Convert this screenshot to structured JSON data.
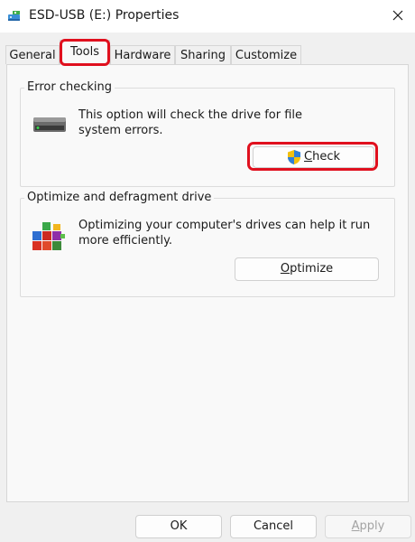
{
  "window": {
    "title": "ESD-USB (E:) Properties",
    "icon": "usb-drive-icon",
    "close_icon": "close-icon"
  },
  "tabs": [
    {
      "label": "General",
      "active": false
    },
    {
      "label": "Tools",
      "active": true
    },
    {
      "label": "Hardware",
      "active": false
    },
    {
      "label": "Sharing",
      "active": false
    },
    {
      "label": "Customize",
      "active": false
    }
  ],
  "error_checking": {
    "title": "Error checking",
    "icon": "drive-icon",
    "description_line1": "This option will check the drive for file",
    "description_line2": "system errors.",
    "button_icon": "uac-shield-icon",
    "button_label_first": "C",
    "button_label_rest": "heck"
  },
  "optimize": {
    "title": "Optimize and defragment drive",
    "icon": "defragment-icon",
    "description_line1": "Optimizing your computer's drives can help it run",
    "description_line2": "more efficiently.",
    "button_label_first": "O",
    "button_label_rest": "ptimize"
  },
  "footer": {
    "ok_label": "OK",
    "cancel_label": "Cancel",
    "apply_label_first": "A",
    "apply_label_rest": "pply",
    "apply_enabled": false
  },
  "colors": {
    "highlight": "#e0101e",
    "background": "#f0f0f0",
    "panel": "#f9f9f9"
  }
}
